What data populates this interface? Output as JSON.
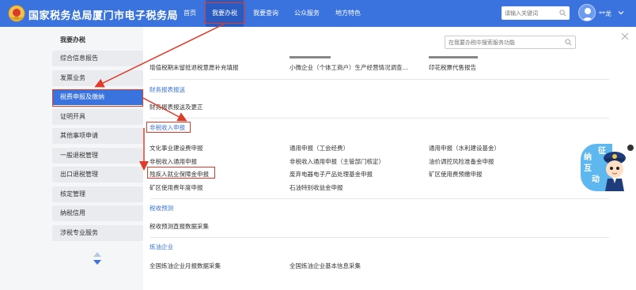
{
  "header": {
    "site_title": "国家税务总局厦门市电子税务局",
    "nav": [
      "首页",
      "我要办税",
      "我要查询",
      "公众服务",
      "地方特色"
    ],
    "search_placeholder": "请输入关键词",
    "username": "**龙"
  },
  "sidebar": {
    "title": "我要办税",
    "items": [
      "综合信息报告",
      "发票业务",
      "税费申报及缴纳",
      "证明开具",
      "其他事项申请",
      "一般退税管理",
      "出口退税管理",
      "核定管理",
      "纳税信用",
      "涉税专业服务"
    ]
  },
  "main": {
    "search_placeholder": "在我要办税中搜索服务功能",
    "top_links": [
      "增值税期末留抵退税意愿补充填报",
      "小微企业（个体工商户）生产经营情况调查...",
      "印花税票代售报告"
    ],
    "sections": [
      {
        "title": "财务报表报送",
        "links": [
          "财务报表报送及更正"
        ]
      },
      {
        "title": "非税收入申报",
        "links": [
          "文化事业建设费申报",
          "通用申报（工会经费）",
          "通用申报（水利建设基金）",
          "非税收入通用申报",
          "非税收入通用申报（主管部门核定）",
          "油价调控风险准备金申报",
          "残疾人就业保障金申报",
          "废弃电器电子产品处理基金申报",
          "矿区使用费预缴申报",
          "矿区使用费年度申报",
          "石油特别收益金申报"
        ]
      },
      {
        "title": "税收预测",
        "links": [
          "税收预测直报数据采集"
        ]
      },
      {
        "title": "炼油企业",
        "links": [
          "全国炼油企业月报数据采集",
          "全国炼油企业基本信息采集"
        ]
      }
    ]
  },
  "widget": {
    "chars": [
      "征",
      "纳",
      "互",
      "动"
    ]
  },
  "colors": {
    "brand": "#3a73de",
    "highlight": "#e03a2a",
    "sidebar_bg": "#f5f6f8"
  }
}
